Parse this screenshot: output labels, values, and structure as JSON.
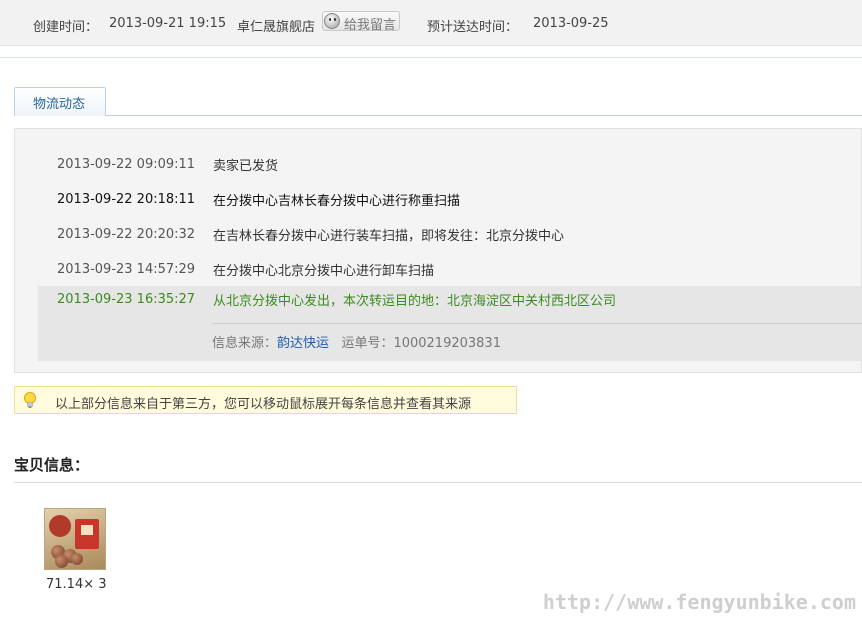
{
  "header": {
    "created_label": "创建时间：",
    "created_value": "2013-09-21 19:15",
    "shop_name": "卓仁晟旗舰店",
    "message_button": "给我留言",
    "eta_label": "预计送达时间：",
    "eta_value": "2013-09-25"
  },
  "tabs": [
    {
      "label": "物流动态",
      "active": true
    }
  ],
  "logistics": {
    "events": [
      {
        "time": "2013-09-22 09:09:11",
        "desc": "卖家已发货"
      },
      {
        "time": "2013-09-22 20:18:11",
        "desc": "在分拨中心吉林长春分拨中心进行称重扫描"
      },
      {
        "time": "2013-09-22 20:20:32",
        "desc": "在吉林长春分拨中心进行装车扫描，即将发往：北京分拨中心"
      },
      {
        "time": "2013-09-23 14:57:29",
        "desc": "在分拨中心北京分拨中心进行卸车扫描"
      },
      {
        "time": "2013-09-23 16:35:27",
        "desc": "从北京分拨中心发出，本次转运目的地：北京海淀区中关村西北区公司"
      }
    ],
    "source_label": "信息来源：",
    "source_link": "韵达快运",
    "waybill_label": "运单号：",
    "waybill_number": "1000219203831"
  },
  "notice": {
    "icon": "lightbulb-icon",
    "text": "以上部分信息来自于第三方，您可以移动鼠标展开每条信息并查看其来源"
  },
  "item_section": {
    "title": "宝贝信息：",
    "items": [
      {
        "qty_text": "71.14× 3"
      }
    ]
  },
  "watermark": "http://www.fengyunbike.com",
  "colors": {
    "link": "#1d5fa6",
    "latest_event": "#3d8b1e",
    "notice_bg": "#fffbdc",
    "tab_border": "#b9d3e3"
  }
}
